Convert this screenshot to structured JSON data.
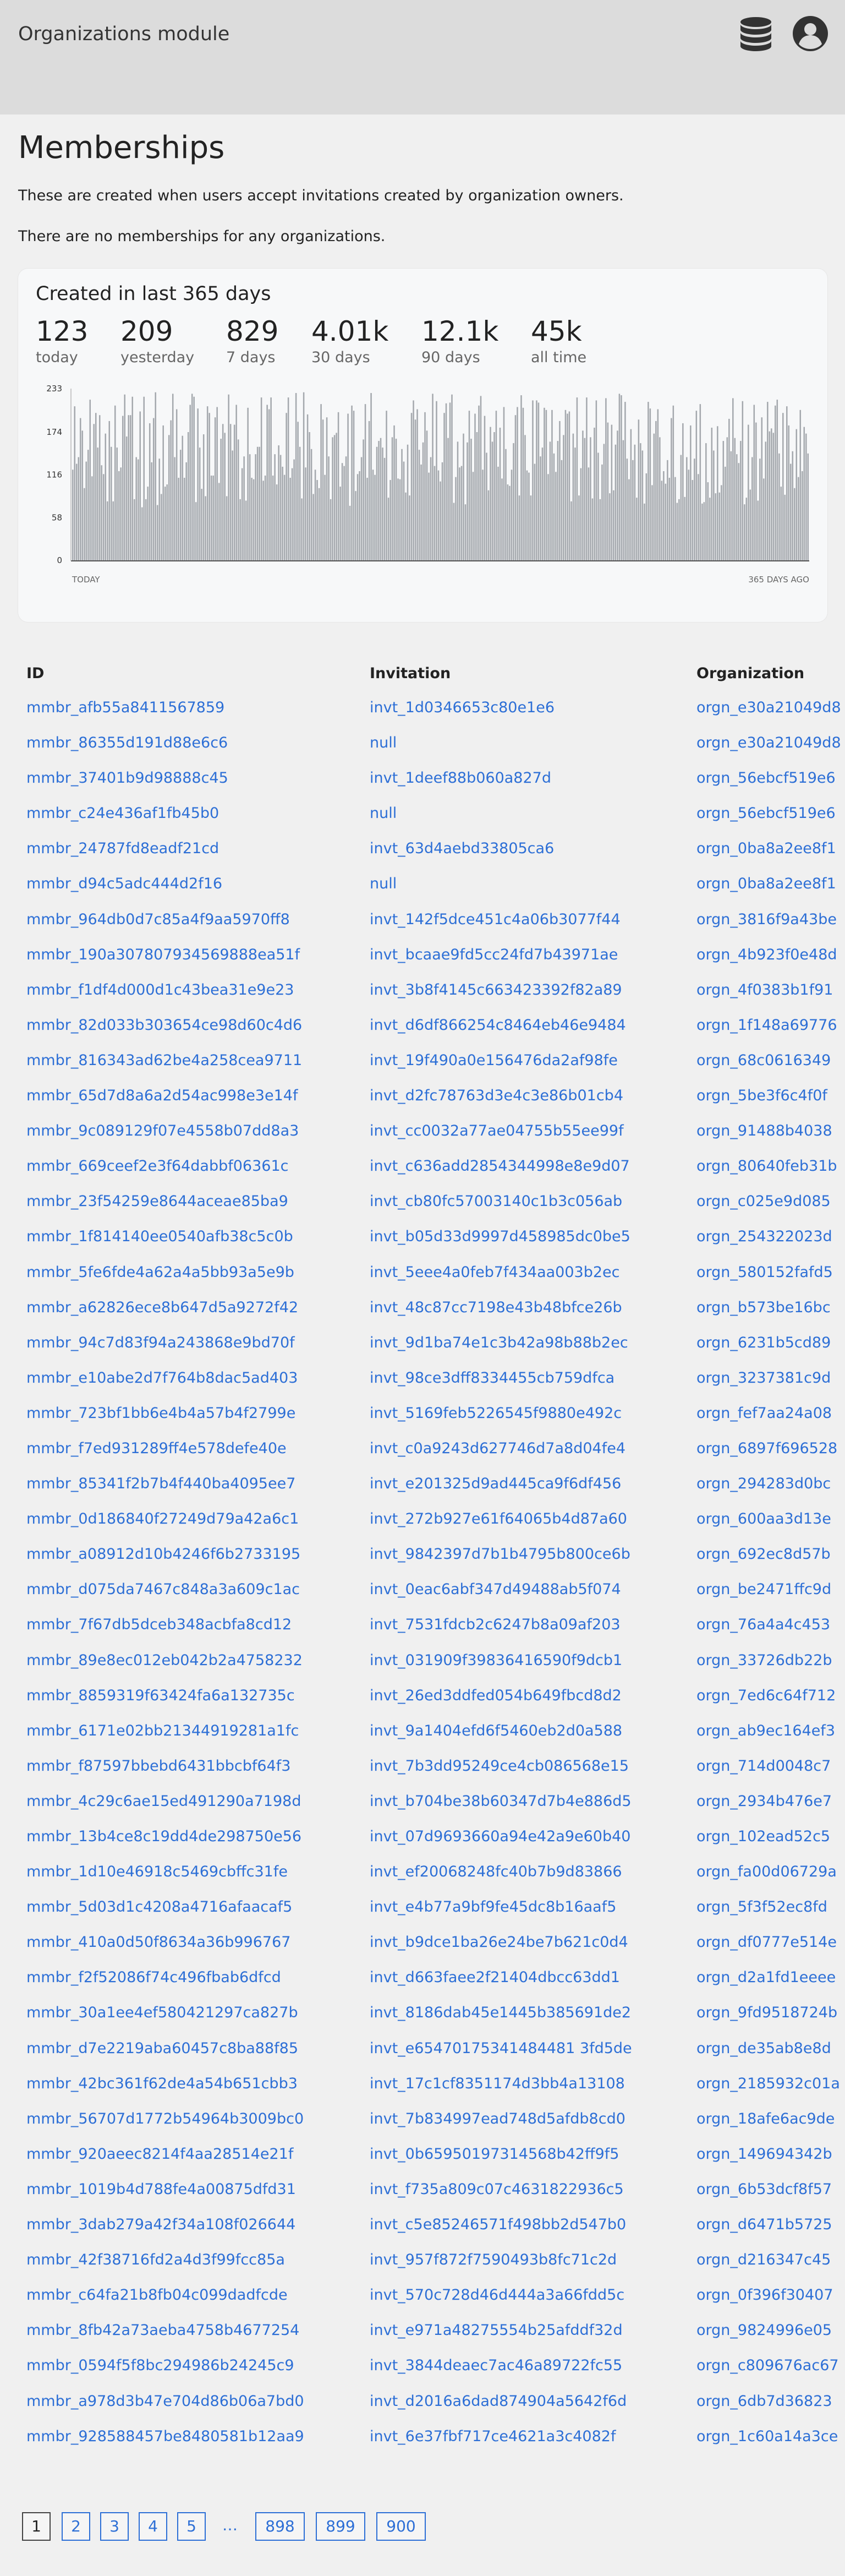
{
  "header": {
    "title": "Organizations module",
    "icons": [
      "database-icon",
      "user-icon"
    ]
  },
  "page": {
    "title": "Memberships",
    "description": "These are created when users accept invitations created by organization owners.",
    "empty_note": "There are no memberships for any organizations."
  },
  "stats": {
    "title": "Created in last 365 days",
    "items": [
      {
        "value": "123",
        "label": "today"
      },
      {
        "value": "209",
        "label": "yesterday"
      },
      {
        "value": "829",
        "label": "7 days"
      },
      {
        "value": "4.01k",
        "label": "30 days"
      },
      {
        "value": "12.1k",
        "label": "90 days"
      },
      {
        "value": "45k",
        "label": "all time"
      }
    ]
  },
  "chart_data": {
    "type": "bar",
    "y_ticks": [
      "233",
      "174",
      "116",
      "58",
      "0"
    ],
    "ylim": [
      0,
      233
    ],
    "x_start_label": "TODAY",
    "x_end_label": "365 DAYS AGO",
    "bar_color": "#a4a8ad",
    "values": [
      123,
      209,
      131,
      140,
      193,
      176,
      98,
      134,
      150,
      218,
      114,
      185,
      200,
      153,
      197,
      129,
      117,
      172,
      80,
      189,
      154,
      80,
      210,
      153,
      121,
      126,
      196,
      225,
      168,
      197,
      197,
      222,
      83,
      140,
      137,
      202,
      72,
      222,
      83,
      100,
      186,
      133,
      193,
      228,
      75,
      138,
      90,
      183,
      100,
      103,
      170,
      190,
      226,
      140,
      205,
      112,
      150,
      169,
      112,
      133,
      174,
      211,
      226,
      222,
      79,
      206,
      153,
      97,
      171,
      87,
      209,
      200,
      115,
      115,
      194,
      208,
      105,
      165,
      185,
      173,
      87,
      225,
      185,
      149,
      184,
      211,
      164,
      83,
      125,
      141,
      81,
      207,
      144,
      112,
      110,
      144,
      154,
      154,
      221,
      108,
      115,
      211,
      205,
      221,
      115,
      144,
      103,
      156,
      143,
      127,
      116,
      200,
      221,
      112,
      125,
      137,
      227,
      188,
      154,
      84,
      228,
      126,
      198,
      174,
      151,
      90,
      123,
      109,
      98,
      212,
      191,
      116,
      194,
      141,
      83,
      167,
      170,
      173,
      201,
      100,
      132,
      128,
      141,
      199,
      74,
      210,
      203,
      94,
      117,
      121,
      140,
      164,
      212,
      112,
      189,
      227,
      123,
      116,
      154,
      162,
      166,
      153,
      139,
      203,
      85,
      109,
      167,
      183,
      165,
      111,
      110,
      151,
      134,
      92,
      157,
      88,
      200,
      217,
      191,
      205,
      150,
      130,
      160,
      201,
      176,
      119,
      140,
      226,
      128,
      216,
      122,
      107,
      133,
      200,
      213,
      166,
      214,
      225,
      78,
      113,
      161,
      126,
      128,
      172,
      76,
      160,
      203,
      165,
      120,
      199,
      174,
      210,
      223,
      123,
      196,
      146,
      95,
      181,
      161,
      174,
      203,
      127,
      180,
      111,
      208,
      151,
      103,
      101,
      123,
      159,
      197,
      208,
      88,
      224,
      207,
      170,
      122,
      119,
      88,
      217,
      131,
      217,
      214,
      141,
      153,
      207,
      204,
      117,
      161,
      204,
      145,
      120,
      162,
      189,
      136,
      170,
      204,
      199,
      202,
      80,
      172,
      153,
      221,
      88,
      125,
      176,
      166,
      221,
      126,
      167,
      84,
      180,
      217,
      146,
      83,
      130,
      158,
      220,
      187,
      91,
      184,
      95,
      157,
      176,
      226,
      224,
      163,
      215,
      138,
      110,
      178,
      136,
      157,
      85,
      191,
      159,
      149,
      77,
      118,
      215,
      206,
      102,
      172,
      189,
      205,
      167,
      108,
      121,
      104,
      136,
      112,
      193,
      210,
      113,
      78,
      83,
      143,
      186,
      86,
      140,
      123,
      183,
      109,
      138,
      203,
      117,
      212,
      77,
      79,
      159,
      106,
      85,
      180,
      149,
      91,
      182,
      92,
      102,
      162,
      127,
      167,
      192,
      148,
      220,
      166,
      144,
      132,
      162,
      216,
      76,
      85,
      184,
      96,
      140,
      211,
      187,
      81,
      138,
      194,
      111,
      161,
      215,
      175,
      179,
      173,
      210,
      218,
      145,
      100,
      200,
      89,
      209,
      183,
      131,
      148,
      98,
      178,
      113,
      204,
      121,
      181,
      172,
      145
    ]
  },
  "table": {
    "headers": {
      "id": "ID",
      "invitation": "Invitation",
      "organization": "Organization"
    },
    "rows": [
      {
        "id": "mmbr_afb55a8411567859",
        "invitation": "invt_1d0346653c80e1e6",
        "organization": "orgn_e30a21049d8"
      },
      {
        "id": "mmbr_86355d191d88e6c6",
        "invitation": "null",
        "organization": "orgn_e30a21049d8"
      },
      {
        "id": "mmbr_37401b9d98888c45",
        "invitation": "invt_1deef88b060a827d",
        "organization": "orgn_56ebcf519e6"
      },
      {
        "id": "mmbr_c24e436af1fb45b0",
        "invitation": "null",
        "organization": "orgn_56ebcf519e6"
      },
      {
        "id": "mmbr_24787fd8eadf21cd",
        "invitation": "invt_63d4aebd33805ca6",
        "organization": "orgn_0ba8a2ee8f1"
      },
      {
        "id": "mmbr_d94c5adc444d2f16",
        "invitation": "null",
        "organization": "orgn_0ba8a2ee8f1"
      },
      {
        "id": "mmbr_964db0d7c85a4f9aa5970ff8",
        "invitation": "invt_142f5dce451c4a06b3077f44",
        "organization": "orgn_3816f9a43be"
      },
      {
        "id": "mmbr_190a307807934569888ea51f",
        "invitation": "invt_bcaae9fd5cc24fd7b43971ae",
        "organization": "orgn_4b923f0e48d"
      },
      {
        "id": "mmbr_f1df4d000d1c43bea31e9e23",
        "invitation": "invt_3b8f4145c663423392f82a89",
        "organization": "orgn_4f0383b1f91"
      },
      {
        "id": "mmbr_82d033b303654ce98d60c4d6",
        "invitation": "invt_d6df866254c8464eb46e9484",
        "organization": "orgn_1f148a69776"
      },
      {
        "id": "mmbr_816343ad62be4a258cea9711",
        "invitation": "invt_19f490a0e156476da2af98fe",
        "organization": "orgn_68c0616349"
      },
      {
        "id": "mmbr_65d7d8a6a2d54ac998e3e14f",
        "invitation": "invt_d2fc78763d3e4c3e86b01cb4",
        "organization": "orgn_5be3f6c4f0f"
      },
      {
        "id": "mmbr_9c089129f07e4558b07dd8a3",
        "invitation": "invt_cc0032a77ae04755b55ee99f",
        "organization": "orgn_91488b4038"
      },
      {
        "id": "mmbr_669ceef2e3f64dabbf06361c",
        "invitation": "invt_c636add2854344998e8e9d07",
        "organization": "orgn_80640feb31b"
      },
      {
        "id": "mmbr_23f54259e8644aceae85ba9",
        "invitation": "invt_cb80fc57003140c1b3c056ab",
        "organization": "orgn_c025e9d085"
      },
      {
        "id": "mmbr_1f814140ee0540afb38c5c0b",
        "invitation": "invt_b05d33d9997d458985dc0be5",
        "organization": "orgn_254322023d"
      },
      {
        "id": "mmbr_5fe6fde4a62a4a5bb93a5e9b",
        "invitation": "invt_5eee4a0feb7f434aa003b2ec",
        "organization": "orgn_580152fafd5"
      },
      {
        "id": "mmbr_a62826ece8b647d5a9272f42",
        "invitation": "invt_48c87cc7198e43b48bfce26b",
        "organization": "orgn_b573be16bc"
      },
      {
        "id": "mmbr_94c7d83f94a243868e9bd70f",
        "invitation": "invt_9d1ba74e1c3b42a98b88b2ec",
        "organization": "orgn_6231b5cd89"
      },
      {
        "id": "mmbr_e10abe2d7f764b8dac5ad403",
        "invitation": "invt_98ce3dff8334455cb759dfca",
        "organization": "orgn_3237381c9d"
      },
      {
        "id": "mmbr_723bf1bb6e4b4a57b4f2799e",
        "invitation": "invt_5169feb5226545f9880e492c",
        "organization": "orgn_fef7aa24a08"
      },
      {
        "id": "mmbr_f7ed931289ff4e578defe40e",
        "invitation": "invt_c0a9243d627746d7a8d04fe4",
        "organization": "orgn_6897f696528"
      },
      {
        "id": "mmbr_85341f2b7b4f440ba4095ee7",
        "invitation": "invt_e201325d9ad445ca9f6df456",
        "organization": "orgn_294283d0bc"
      },
      {
        "id": "mmbr_0d186840f27249d79a42a6c1",
        "invitation": "invt_272b927e61f64065b4d87a60",
        "organization": "orgn_600aa3d13e"
      },
      {
        "id": "mmbr_a08912d10b4246f6b2733195",
        "invitation": "invt_9842397d7b1b4795b800ce6b",
        "organization": "orgn_692ec8d57b"
      },
      {
        "id": "mmbr_d075da7467c848a3a609c1ac",
        "invitation": "invt_0eac6abf347d49488ab5f074",
        "organization": "orgn_be2471ffc9d"
      },
      {
        "id": "mmbr_7f67db5dceb348acbfa8cd12",
        "invitation": "invt_7531fdcb2c6247b8a09af203",
        "organization": "orgn_76a4a4c453"
      },
      {
        "id": "mmbr_89e8ec012eb042b2a4758232",
        "invitation": "invt_031909f39836416590f9dcb1",
        "organization": "orgn_33726db22b"
      },
      {
        "id": "mmbr_8859319f63424fa6a132735c",
        "invitation": "invt_26ed3ddfed054b649fbcd8d2",
        "organization": "orgn_7ed6c64f712"
      },
      {
        "id": "mmbr_6171e02bb21344919281a1fc",
        "invitation": "invt_9a1404efd6f5460eb2d0a588",
        "organization": "orgn_ab9ec164ef3"
      },
      {
        "id": "mmbr_f87597bbebd6431bbcbf64f3",
        "invitation": "invt_7b3dd95249ce4cb086568e15",
        "organization": "orgn_714d0048c7"
      },
      {
        "id": "mmbr_4c29c6ae15ed491290a7198d",
        "invitation": "invt_b704be38b60347d7b4e886d5",
        "organization": "orgn_2934b476e7"
      },
      {
        "id": "mmbr_13b4ce8c19dd4de298750e56",
        "invitation": "invt_07d9693660a94e42a9e60b40",
        "organization": "orgn_102ead52c5"
      },
      {
        "id": "mmbr_1d10e46918c5469cbffc31fe",
        "invitation": "invt_ef20068248fc40b7b9d83866",
        "organization": "orgn_fa00d06729a"
      },
      {
        "id": "mmbr_5d03d1c4208a4716afaacaf5",
        "invitation": "invt_e4b77a9bf9fe45dc8b16aaf5",
        "organization": "orgn_5f3f52ec8fd"
      },
      {
        "id": "mmbr_410a0d50f8634a36b996767",
        "invitation": "invt_b9dce1ba26e24be7b621c0d4",
        "organization": "orgn_df0777e514e"
      },
      {
        "id": "mmbr_f2f52086f74c496fbab6dfcd",
        "invitation": "invt_d663faee2f21404dbcc63dd1",
        "organization": "orgn_d2a1fd1eeee"
      },
      {
        "id": "mmbr_30a1ee4ef580421297ca827b",
        "invitation": "invt_8186dab45e1445b385691de2",
        "organization": "orgn_9fd9518724b"
      },
      {
        "id": "mmbr_d7e2219aba60457c8ba88f85",
        "invitation": "invt_e65470175341484481 3fd5de",
        "organization": "orgn_de35ab8e8d"
      },
      {
        "id": "mmbr_42bc361f62de4a54b651cbb3",
        "invitation": "invt_17c1cf8351174d3bb4a13108",
        "organization": "orgn_2185932c01a"
      },
      {
        "id": "mmbr_56707d1772b54964b3009bc0",
        "invitation": "invt_7b834997ead748d5afdb8cd0",
        "organization": "orgn_18afe6ac9de"
      },
      {
        "id": "mmbr_920aeec8214f4aa28514e21f",
        "invitation": "invt_0b65950197314568b42ff9f5",
        "organization": "orgn_149694342b"
      },
      {
        "id": "mmbr_1019b4d788fe4a00875dfd31",
        "invitation": "invt_f735a809c07c4631822936c5",
        "organization": "orgn_6b53dcf8f57"
      },
      {
        "id": "mmbr_3dab279a42f34a108f026644",
        "invitation": "invt_c5e85246571f498bb2d547b0",
        "organization": "orgn_d6471b5725"
      },
      {
        "id": "mmbr_42f38716fd2a4d3f99fcc85a",
        "invitation": "invt_957f872f7590493b8fc71c2d",
        "organization": "orgn_d216347c45"
      },
      {
        "id": "mmbr_c64fa21b8fb04c099dadfcde",
        "invitation": "invt_570c728d46d444a3a66fdd5c",
        "organization": "orgn_0f396f30407"
      },
      {
        "id": "mmbr_8fb42a73aeba4758b4677254",
        "invitation": "invt_e971a48275554b25afddf32d",
        "organization": "orgn_9824996e05"
      },
      {
        "id": "mmbr_0594f5f8bc294986b24245c9",
        "invitation": "invt_3844deaec7ac46a89722fc55",
        "organization": "orgn_c809676ac67"
      },
      {
        "id": "mmbr_a978d3b47e704d86b06a7bd0",
        "invitation": "invt_d2016a6dad874904a5642f6d",
        "organization": "orgn_6db7d36823"
      },
      {
        "id": "mmbr_928588457be8480581b12aa9",
        "invitation": "invt_6e37fbf717ce4621a3c4082f",
        "organization": "orgn_1c60a14a3ce"
      }
    ]
  },
  "pagination": {
    "pages": [
      "1",
      "2",
      "3",
      "4",
      "5",
      "…",
      "898",
      "899",
      "900"
    ],
    "current": "1"
  }
}
